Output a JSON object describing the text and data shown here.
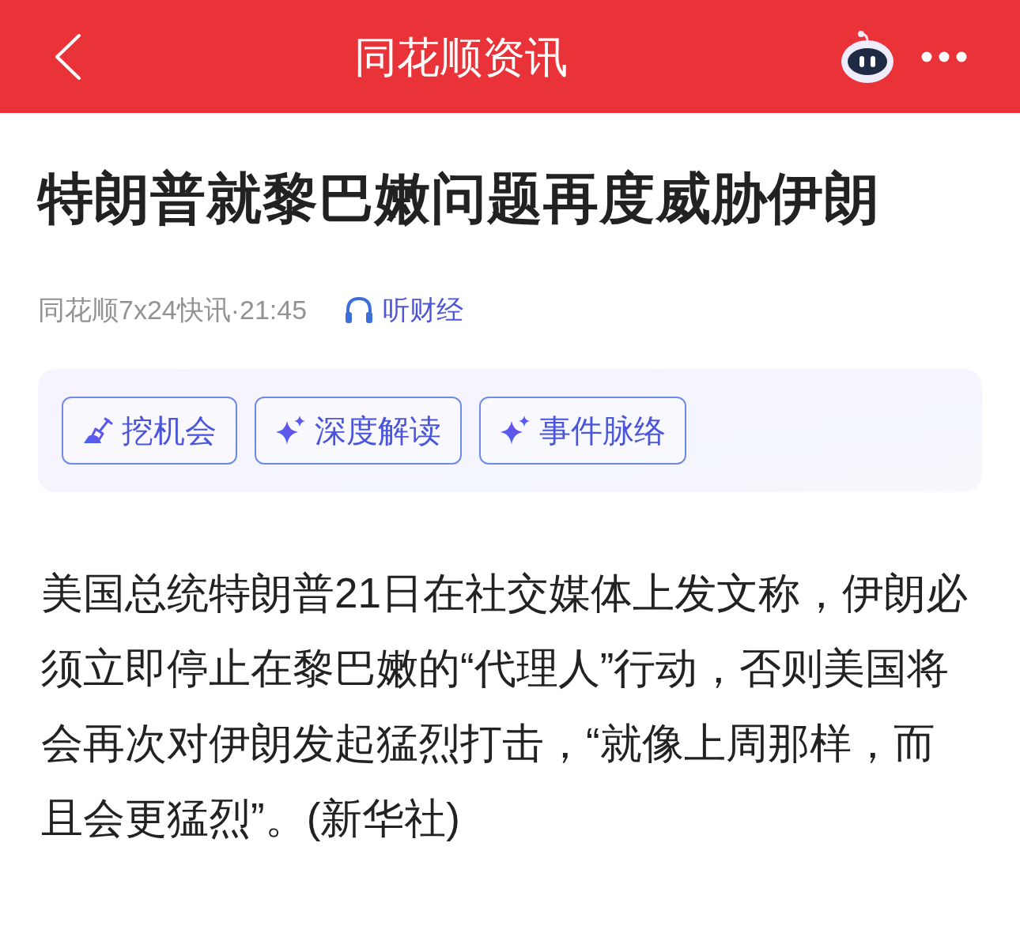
{
  "header": {
    "title": "同花顺资讯"
  },
  "article": {
    "title": "特朗普就黎巴嫩问题再度威胁伊朗",
    "meta": "同花顺7x24快讯·21:45",
    "listen_link": "听财经"
  },
  "ai_tools": [
    {
      "kind": "dig",
      "label": "挖机会"
    },
    {
      "kind": "sparkle",
      "label": "深度解读"
    },
    {
      "kind": "sparkle",
      "label": "事件脉络"
    }
  ],
  "body": "美国总统特朗普21日在社交媒体上发文称，伊朗必须立即停止在黎巴嫩的“代理人”行动，否则美国将会再次对伊朗发起猛烈打击，“就像上周那样，而且会更猛烈”。(新华社)"
}
